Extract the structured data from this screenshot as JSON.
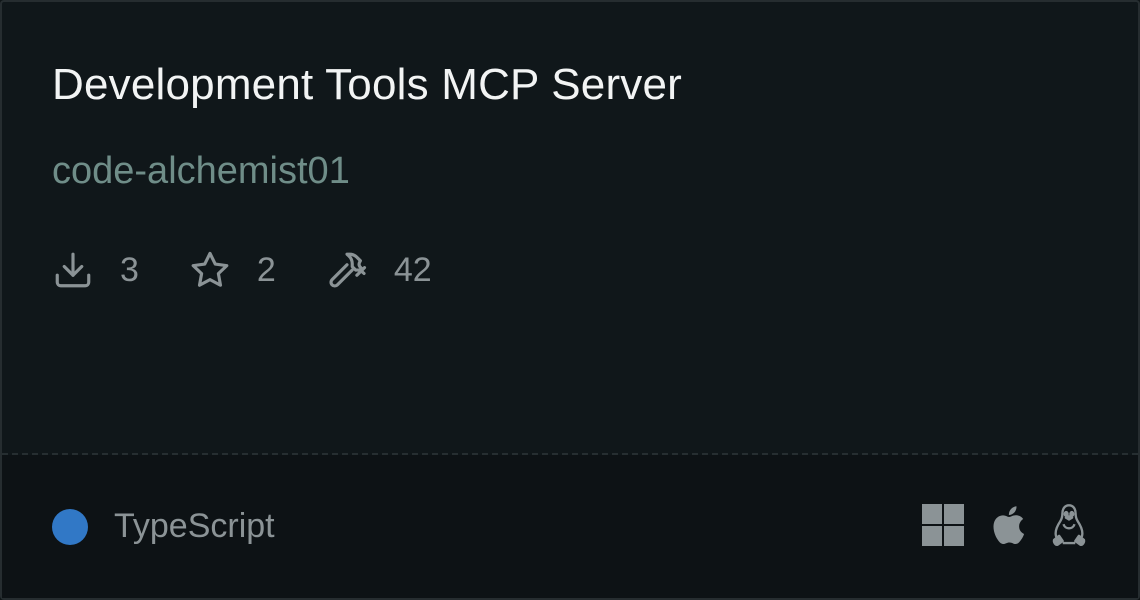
{
  "card": {
    "title": "Development Tools MCP Server",
    "author": "code-alchemist01",
    "stats": {
      "downloads": "3",
      "stars": "2",
      "tools": "42"
    },
    "language": {
      "name": "TypeScript",
      "color": "#3178c6"
    },
    "platforms": [
      "windows-icon",
      "apple-icon",
      "linux-icon"
    ]
  },
  "colors": {
    "background": "#10171a",
    "footer_background": "#0d1215",
    "title": "#f2f4f4",
    "author": "#6f8d88",
    "muted": "#8b9396",
    "icon": "#8b9396"
  }
}
